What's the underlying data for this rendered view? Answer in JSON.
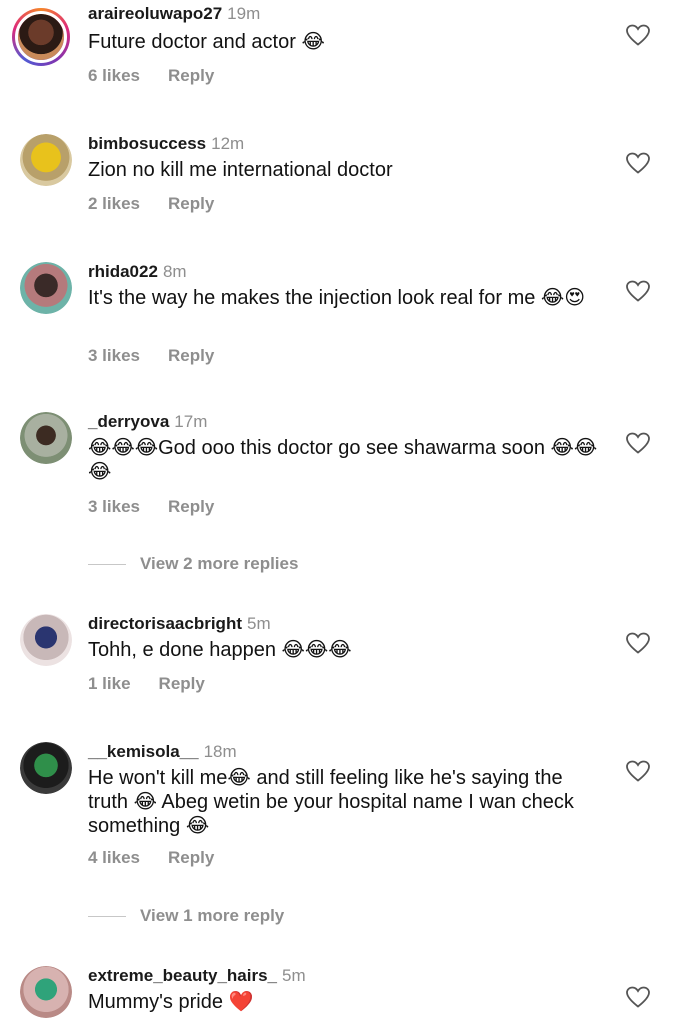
{
  "comments": [
    {
      "user": "araireoluwapo27",
      "time": "19m",
      "text": "Future doctor and actor 😂",
      "likes": "6 likes",
      "reply": "Reply"
    },
    {
      "user": "bimbosuccess",
      "time": "12m",
      "text": "Zion no kill me international doctor",
      "likes": "2 likes",
      "reply": "Reply"
    },
    {
      "user": "rhida022",
      "time": "8m",
      "text": "It's the way he makes the injection look real for me 😂😍",
      "likes": "3 likes",
      "reply": "Reply"
    },
    {
      "user": "_derryova",
      "time": "17m",
      "text": "😂😂😂God ooo this doctor go see shawarma soon 😂😂😂",
      "likes": "3 likes",
      "reply": "Reply"
    },
    {
      "user": "directorisaacbright",
      "time": "5m",
      "text": "Tohh, e done happen 😂😂😂",
      "likes": "1 like",
      "reply": "Reply"
    },
    {
      "user": "__kemisola__",
      "time": "18m",
      "text": "He won't kill me😂 and still feeling like he's saying the truth 😂 Abeg wetin be your hospital name I wan check something 😂",
      "likes": "4 likes",
      "reply": "Reply"
    },
    {
      "user": "extreme_beauty_hairs_",
      "time": "5m",
      "text": "Mummy's pride ❤️"
    }
  ],
  "view_replies": [
    "View 2 more replies",
    "View 1 more reply"
  ],
  "icons": {
    "like": "heart-outline-icon"
  }
}
